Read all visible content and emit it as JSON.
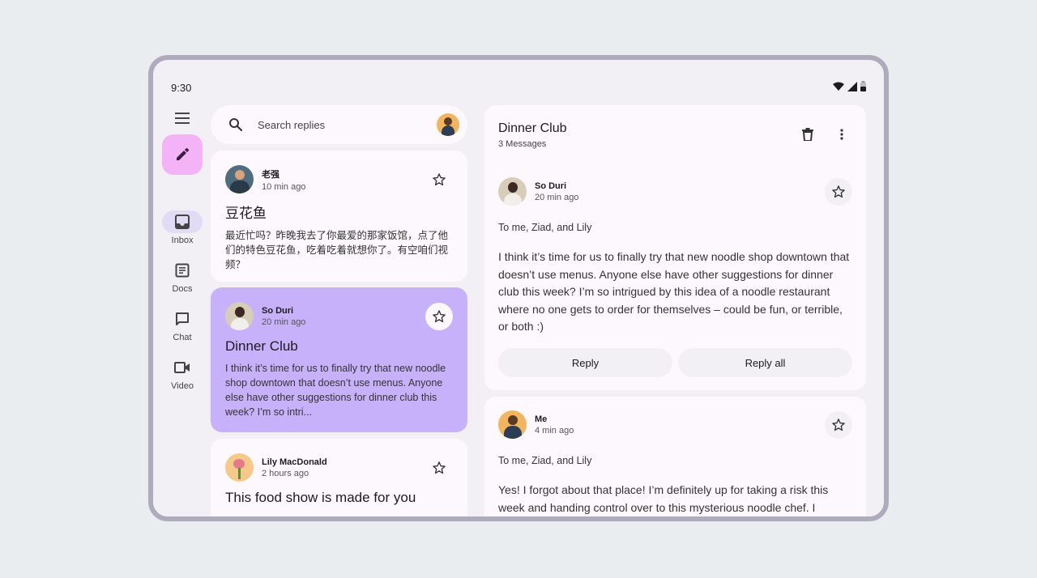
{
  "status_bar": {
    "time": "9:30"
  },
  "nav_rail": {
    "items": [
      {
        "label": "Inbox",
        "icon": "inbox-icon",
        "active": true
      },
      {
        "label": "Docs",
        "icon": "docs-icon",
        "active": false
      },
      {
        "label": "Chat",
        "icon": "chat-icon",
        "active": false
      },
      {
        "label": "Video",
        "icon": "video-icon",
        "active": false
      }
    ]
  },
  "search": {
    "placeholder": "Search replies"
  },
  "list": {
    "cards": [
      {
        "sender": "老强",
        "time": "10 min ago",
        "title": "豆花鱼",
        "preview": "最近忙吗？昨晚我去了你最爱的那家饭馆，点了他们的特色豆花鱼，吃着吃着就想你了。有空咱们视频？"
      },
      {
        "sender": "So Duri",
        "time": "20 min ago",
        "title": "Dinner Club",
        "preview": "I think it’s time for us to finally try that new noodle shop downtown that doesn’t use menus. Anyone else have other suggestions for dinner club this week? I’m so intri..."
      },
      {
        "sender": "Lily MacDonald",
        "time": "2 hours ago",
        "title": "This food show is made for you"
      }
    ]
  },
  "detail": {
    "title": "Dinner Club",
    "subtitle": "3 Messages",
    "messages": [
      {
        "sender": "So Duri",
        "time": "20 min ago",
        "to": "To me, Ziad, and Lily",
        "body": "I think it’s time for us to finally try that new noodle shop downtown that doesn’t use menus. Anyone else have other suggestions for dinner club this week? I’m so intrigued by this idea of a noodle restaurant where no one gets to order for themselves – could be fun, or terrible, or both :)"
      },
      {
        "sender": "Me",
        "time": "4 min ago",
        "to": "To me, Ziad, and Lily",
        "body": "Yes! I forgot about that place! I’m definitely up for taking a risk this week and handing control over to this mysterious noodle chef. I"
      }
    ],
    "reply_label": "Reply",
    "reply_all_label": "Reply all"
  },
  "colors": {
    "fab": "#f3b3f6",
    "selected_card": "#c7b1fb",
    "active_nav": "#e1dcf4",
    "surface": "#fdf8fd"
  }
}
